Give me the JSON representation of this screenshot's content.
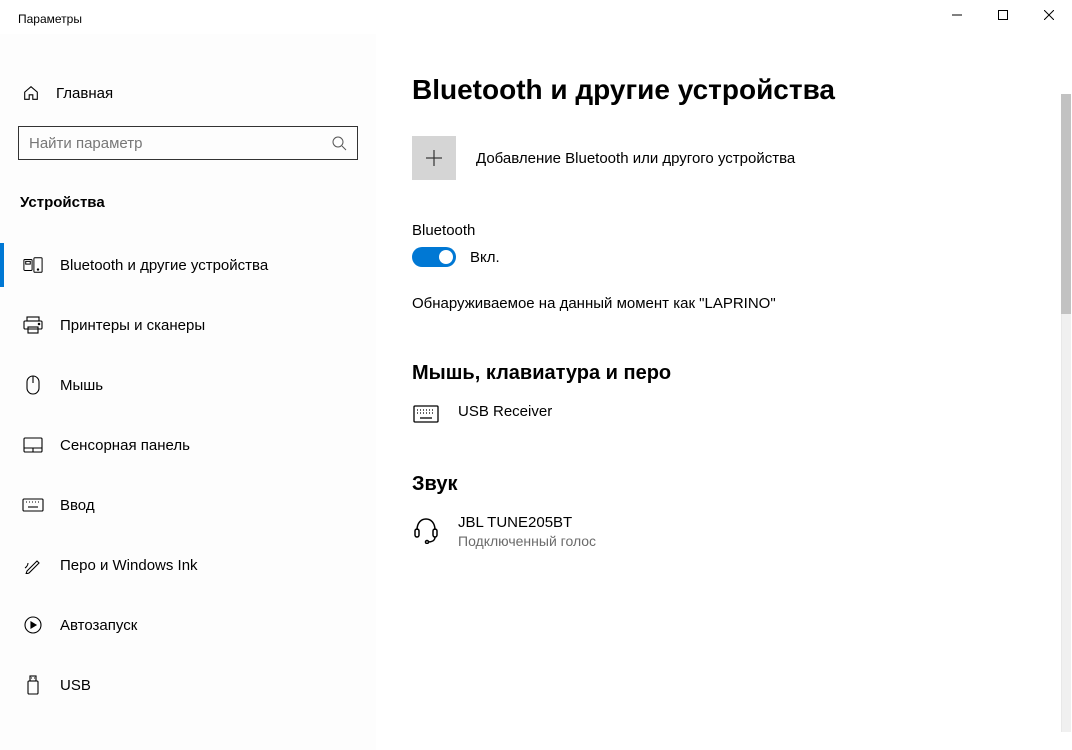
{
  "window": {
    "title": "Параметры"
  },
  "sidebar": {
    "home_label": "Главная",
    "search_placeholder": "Найти параметр",
    "category": "Устройства",
    "items": [
      {
        "label": "Bluetooth и другие устройства"
      },
      {
        "label": "Принтеры и сканеры"
      },
      {
        "label": "Мышь"
      },
      {
        "label": "Сенсорная панель"
      },
      {
        "label": "Ввод"
      },
      {
        "label": "Перо и Windows Ink"
      },
      {
        "label": "Автозапуск"
      },
      {
        "label": "USB"
      }
    ]
  },
  "main": {
    "title": "Bluetooth и другие устройства",
    "add_label": "Добавление Bluetooth или другого устройства",
    "bt_section_label": "Bluetooth",
    "bt_toggle_state": "Вкл.",
    "discoverable_text": "Обнаруживаемое на данный момент как \"LAPRINO\"",
    "groups": [
      {
        "heading": "Мышь, клавиатура и перо",
        "devices": [
          {
            "name": "USB Receiver",
            "sub": ""
          }
        ]
      },
      {
        "heading": "Звук",
        "devices": [
          {
            "name": "JBL TUNE205BT",
            "sub": "Подключенный голос"
          }
        ]
      }
    ]
  }
}
